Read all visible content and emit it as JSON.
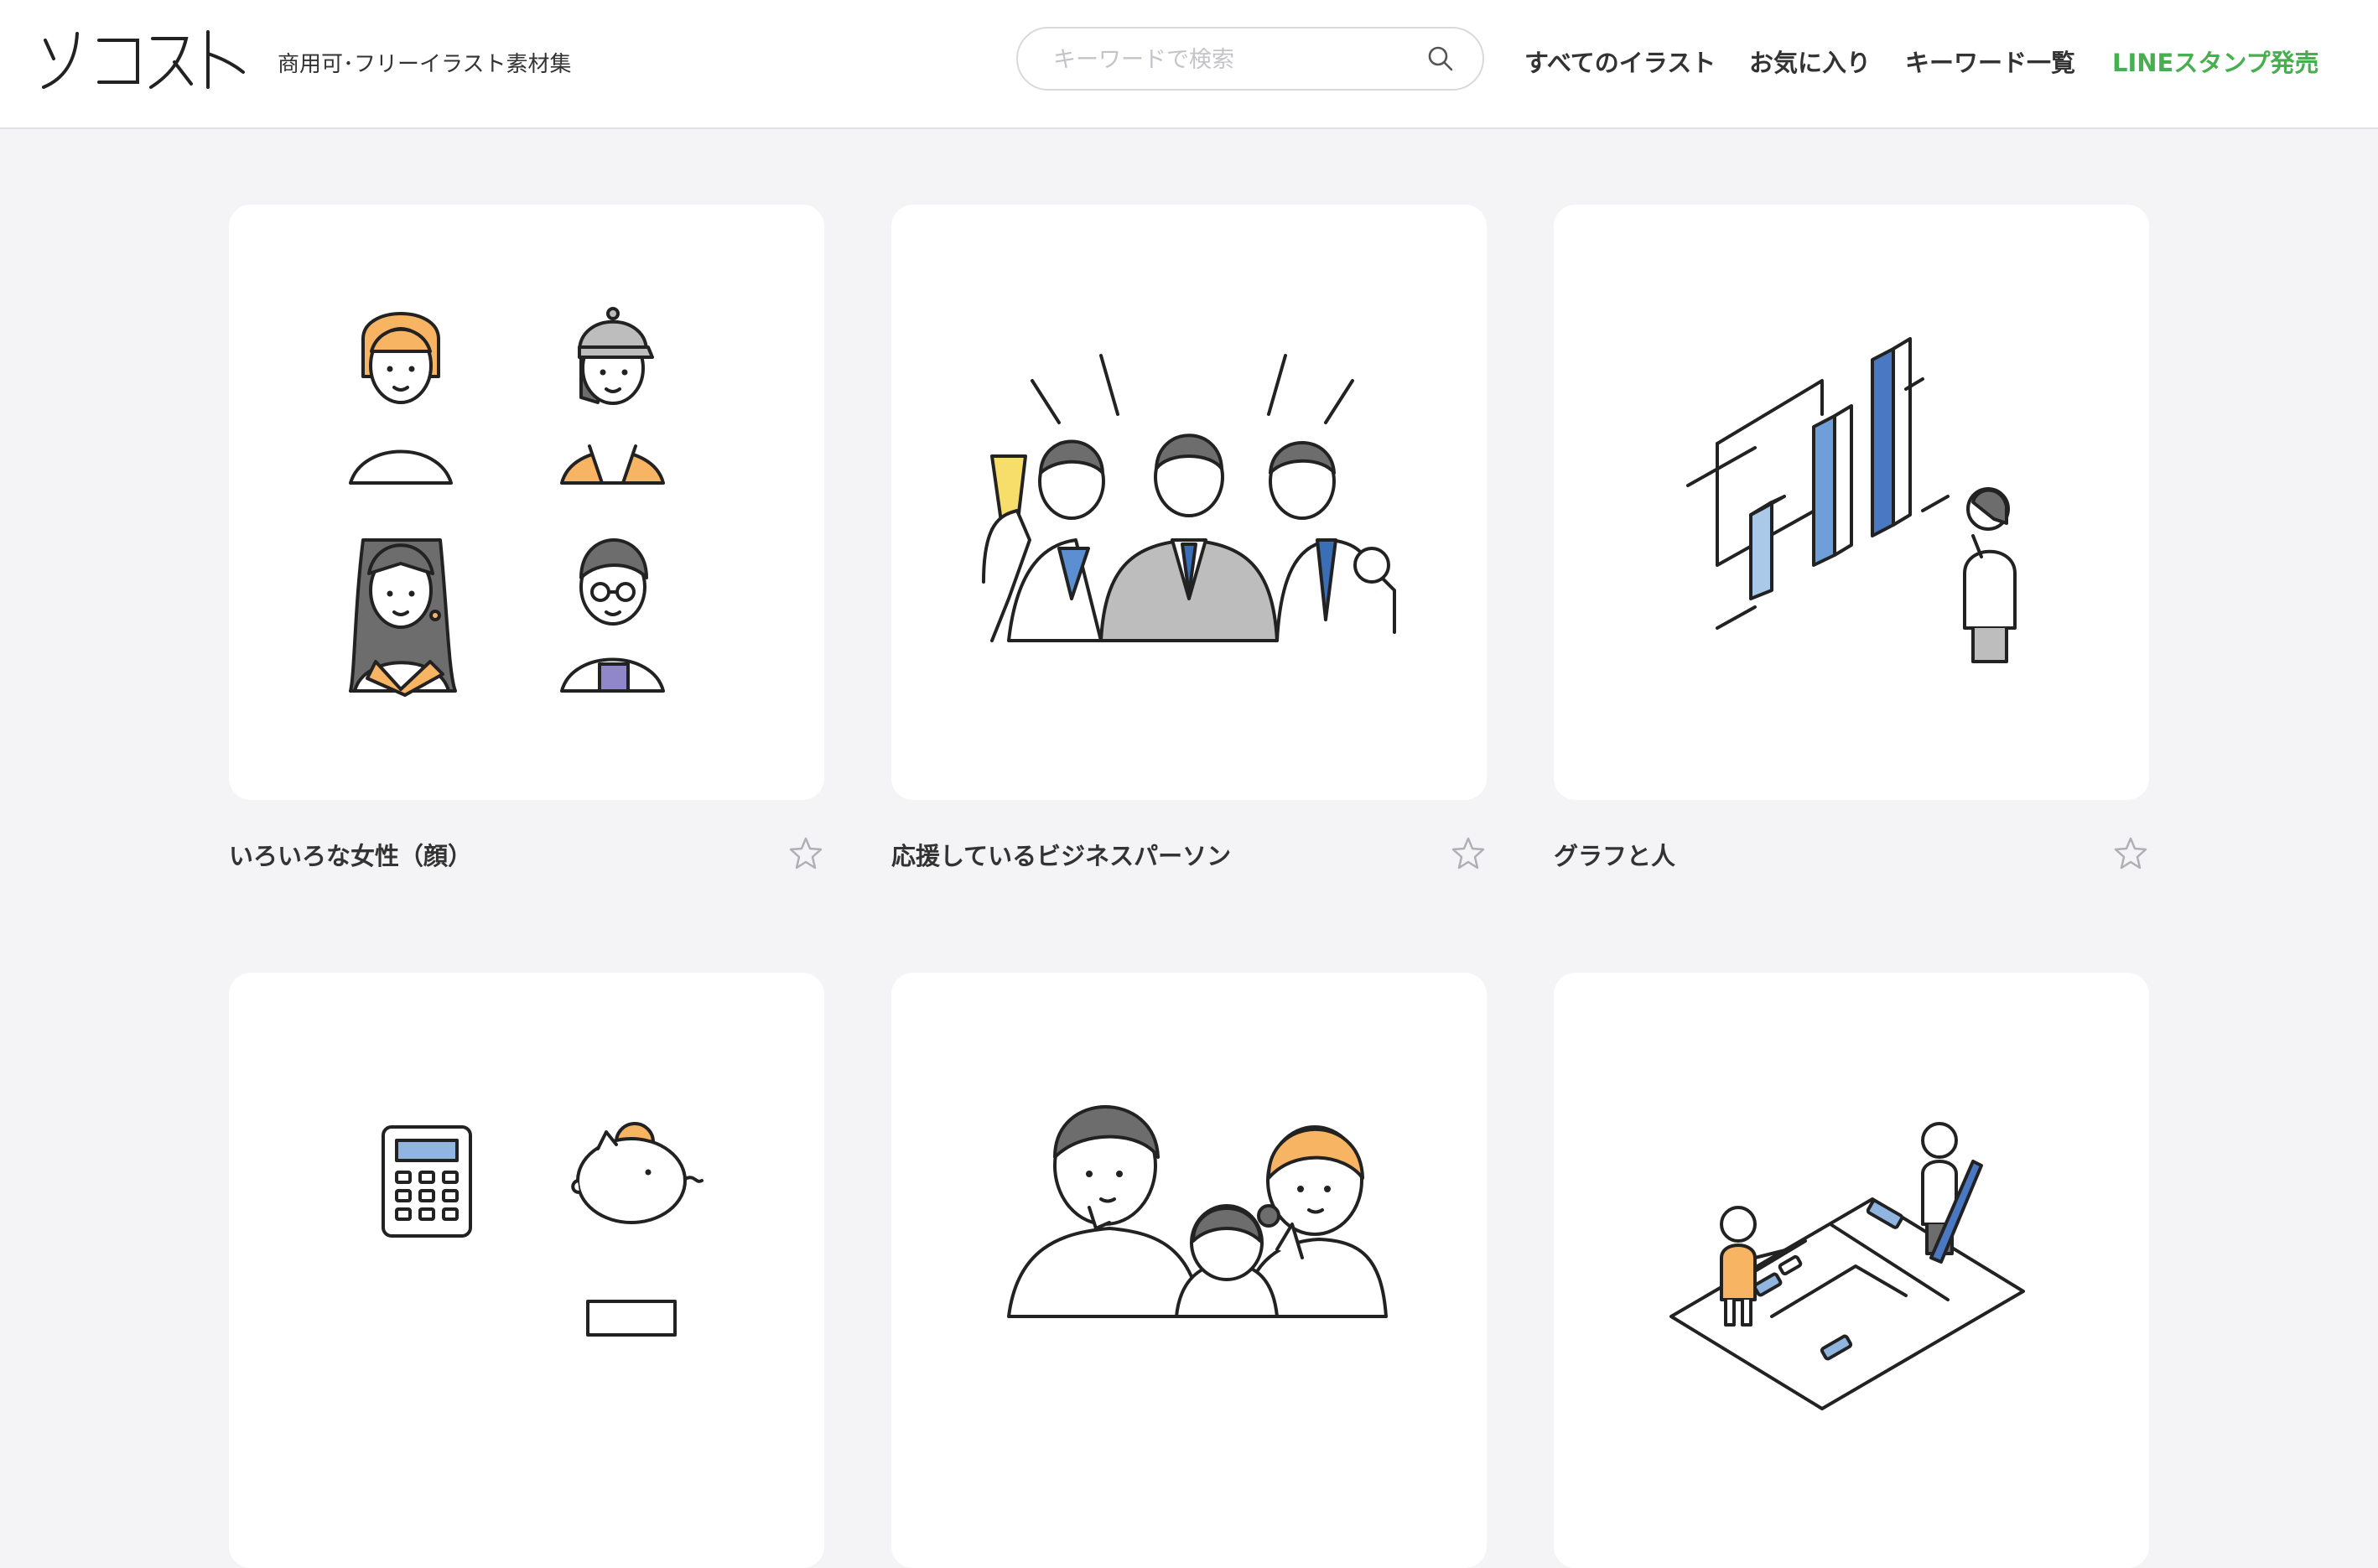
{
  "header": {
    "logo_text": "ソコスト",
    "tagline": "商用可･フリーイラスト素材集",
    "search_placeholder": "キーワードで検索",
    "nav": [
      "すべてのイラスト",
      "お気に入り",
      "キーワード一覧",
      "LINEスタンプ発売"
    ],
    "accent_color": "#46b050"
  },
  "illustrations": [
    {
      "title": "いろいろな女性（顔）"
    },
    {
      "title": "応援しているビジネスパーソン"
    },
    {
      "title": "グラフと人"
    },
    {
      "title": ""
    },
    {
      "title": ""
    },
    {
      "title": ""
    }
  ],
  "icons": [
    "search-icon",
    "star-icon"
  ]
}
